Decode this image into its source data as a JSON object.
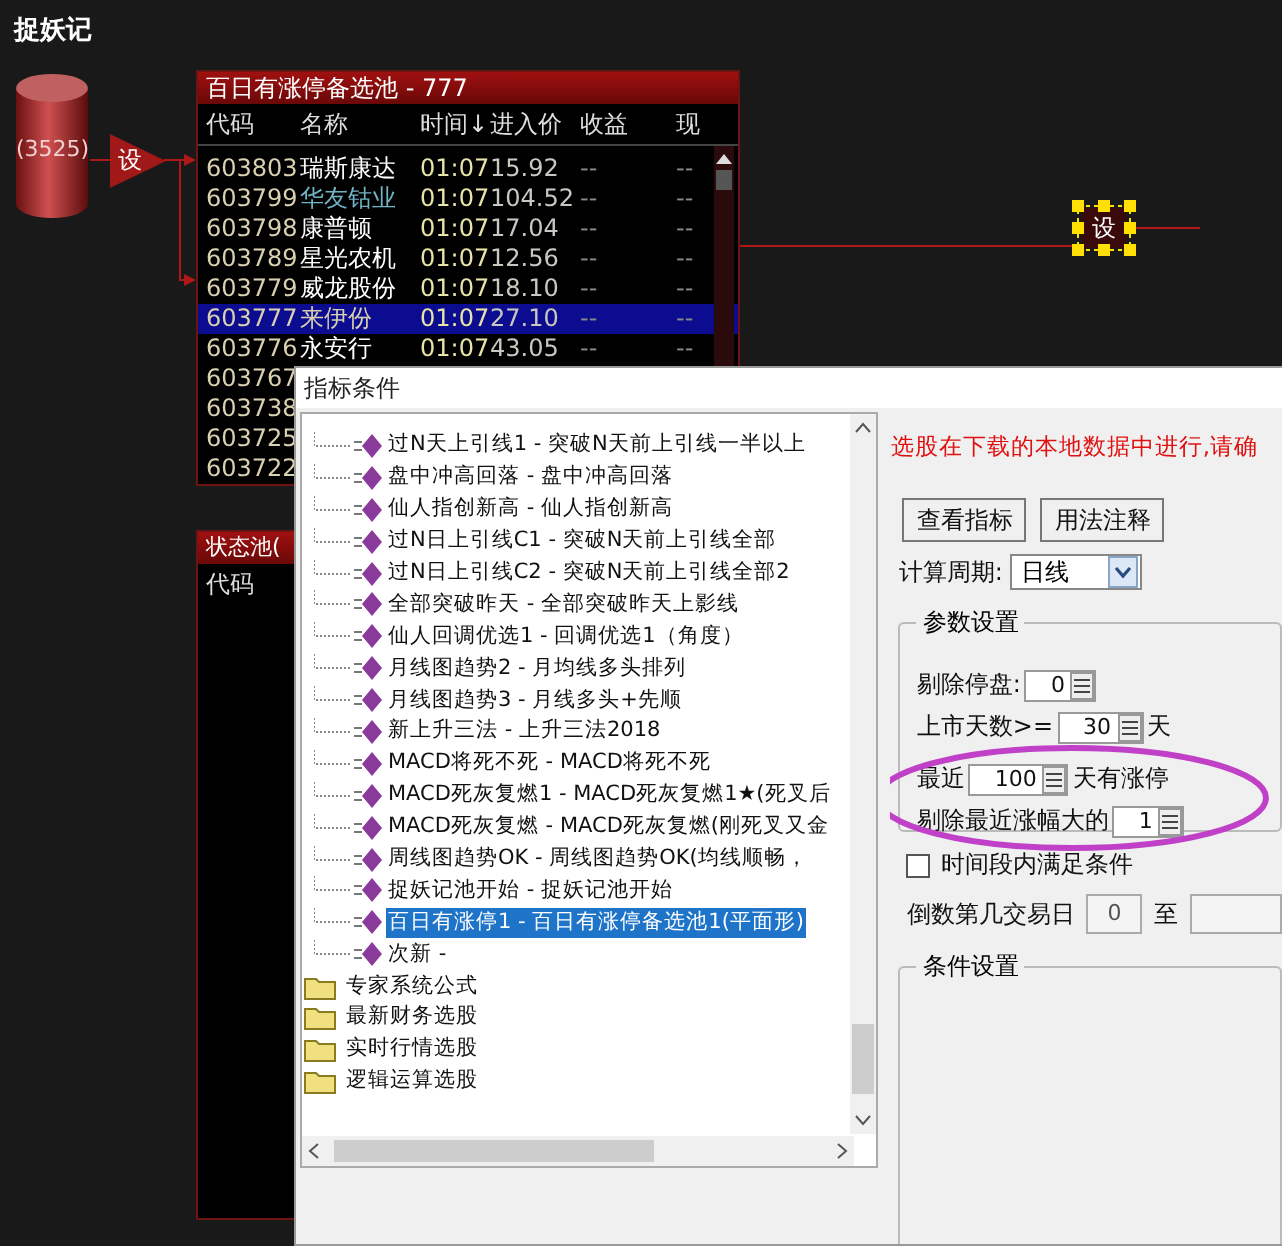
{
  "app": {
    "title": "捉妖记"
  },
  "diagram": {
    "source": {
      "count": "(3525)"
    },
    "filter_nodes": [
      {
        "label": "设",
        "selected": false
      },
      {
        "label": "设",
        "selected": true
      }
    ]
  },
  "pool": {
    "title": "百日有涨停备选池 - 777",
    "columns": [
      "代码",
      "名称",
      "时间↓",
      "进入价",
      "收益",
      "现"
    ],
    "rows": [
      {
        "code": "603803",
        "name": "瑞斯康达",
        "color": "#ffffff",
        "time": "01:07",
        "price": "15.92",
        "profit": "--",
        "current": "--",
        "selected": false
      },
      {
        "code": "603799",
        "name": "华友钴业",
        "color": "#6fb3c4",
        "time": "01:07",
        "price": "104.52",
        "profit": "--",
        "current": "--",
        "selected": false
      },
      {
        "code": "603798",
        "name": "康普顿",
        "color": "#ffffff",
        "time": "01:07",
        "price": "17.04",
        "profit": "--",
        "current": "--",
        "selected": false
      },
      {
        "code": "603789",
        "name": "星光农机",
        "color": "#ffffff",
        "time": "01:07",
        "price": "12.56",
        "profit": "--",
        "current": "--",
        "selected": false
      },
      {
        "code": "603779",
        "name": "威龙股份",
        "color": "#ffffff",
        "time": "01:07",
        "price": "18.10",
        "profit": "--",
        "current": "--",
        "selected": false
      },
      {
        "code": "603777",
        "name": "来伊份",
        "time": "01:07",
        "price": "27.10",
        "profit": "--",
        "current": "--",
        "selected": true
      },
      {
        "code": "603776",
        "name": "永安行",
        "color": "#ffffff",
        "time": "01:07",
        "price": "43.05",
        "profit": "--",
        "current": "--",
        "selected": false
      },
      {
        "code": "603767",
        "selected": false
      },
      {
        "code": "603738",
        "selected": false
      },
      {
        "code": "603725",
        "selected": false
      },
      {
        "code": "603722",
        "selected": false
      }
    ]
  },
  "status_pool": {
    "title": "状态池(",
    "columns": [
      "代码"
    ]
  },
  "dialog": {
    "title": "指标条件",
    "tree": {
      "items": [
        {
          "kind": "formula",
          "label": "过N天上引线1 - 突破N天前上引线一半以上",
          "selected": false
        },
        {
          "kind": "formula",
          "label": "盘中冲高回落 - 盘中冲高回落",
          "selected": false
        },
        {
          "kind": "formula",
          "label": "仙人指创新高 - 仙人指创新高",
          "selected": false
        },
        {
          "kind": "formula",
          "label": "过N日上引线C1 - 突破N天前上引线全部",
          "selected": false
        },
        {
          "kind": "formula",
          "label": "过N日上引线C2 - 突破N天前上引线全部2",
          "selected": false
        },
        {
          "kind": "formula",
          "label": "全部突破昨天 - 全部突破昨天上影线",
          "selected": false
        },
        {
          "kind": "formula",
          "label": "仙人回调优选1 - 回调优选1（角度）",
          "selected": false
        },
        {
          "kind": "formula",
          "label": "月线图趋势2 - 月均线多头排列",
          "selected": false
        },
        {
          "kind": "formula",
          "label": "月线图趋势3 - 月线多头+先顺",
          "selected": false
        },
        {
          "kind": "formula",
          "label": "新上升三法 - 上升三法2018",
          "selected": false
        },
        {
          "kind": "formula",
          "label": "MACD将死不死 - MACD将死不死",
          "selected": false
        },
        {
          "kind": "formula",
          "label": "MACD死灰复燃1 - MACD死灰复燃1★(死叉后",
          "selected": false
        },
        {
          "kind": "formula",
          "label": "MACD死灰复燃 - MACD死灰复燃(刚死叉又金",
          "selected": false
        },
        {
          "kind": "formula",
          "label": "周线图趋势OK - 周线图趋势OK(均线顺畅，",
          "selected": false
        },
        {
          "kind": "formula",
          "label": "捉妖记池开始 - 捉妖记池开始",
          "selected": false
        },
        {
          "kind": "formula",
          "label": "百日有涨停1 - 百日有涨停备选池1(平面形)",
          "selected": true
        },
        {
          "kind": "formula",
          "label": "次新 -",
          "selected": false
        },
        {
          "kind": "folder",
          "label": "专家系统公式",
          "selected": false
        },
        {
          "kind": "folder",
          "label": "最新财务选股",
          "selected": false
        },
        {
          "kind": "folder",
          "label": "实时行情选股",
          "selected": false
        },
        {
          "kind": "folder",
          "label": "逻辑运算选股",
          "selected": false
        }
      ]
    },
    "notice": "选股在下载的本地数据中进行,请确",
    "buttons": [
      "查看指标",
      "用法注释"
    ],
    "period": {
      "label": "计算周期:",
      "value": "日线"
    },
    "params": {
      "title": "参数设置",
      "rows": [
        {
          "label": "剔除停盘:",
          "value": "0",
          "circled": false
        },
        {
          "label": "上市天数>=",
          "value": "30",
          "unit": "天",
          "circled": false
        },
        {
          "label": "最近",
          "value": "100",
          "unit": "天有涨停",
          "circled": true
        },
        {
          "label": "剔除最近涨幅大的",
          "value": "1",
          "circled": true
        }
      ]
    },
    "time_range": {
      "label": "时间段内满足条件",
      "checked": false,
      "from_label": "倒数第几交易日",
      "from": "0",
      "to_label": "至"
    },
    "conditions": {
      "title": "条件设置"
    }
  }
}
